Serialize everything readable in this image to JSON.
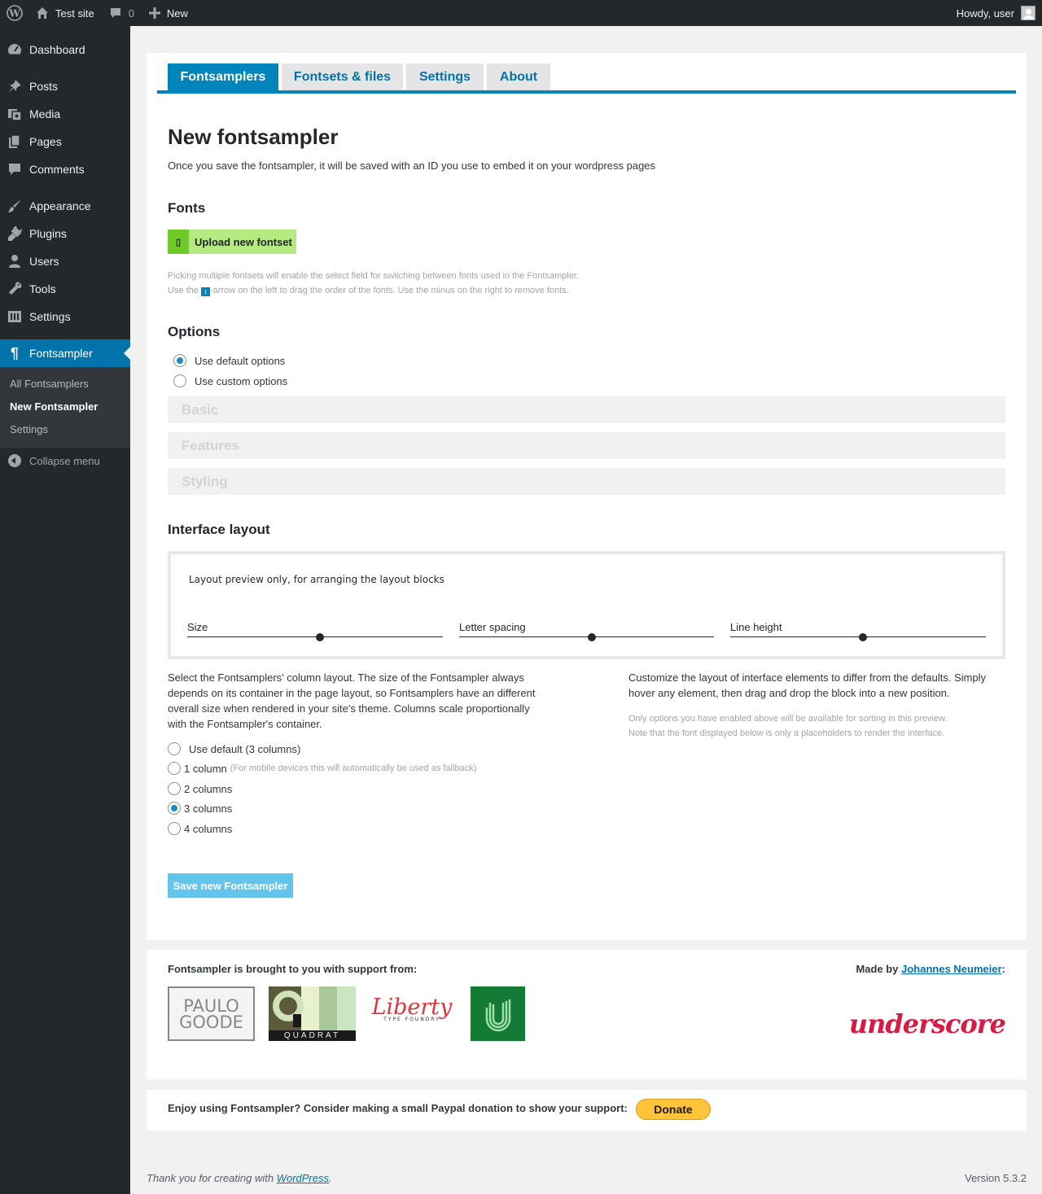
{
  "adminbar": {
    "site_name": "Test site",
    "comments_count": "0",
    "new_label": "New",
    "howdy": "Howdy, user"
  },
  "sidebar": {
    "items": [
      {
        "label": "Dashboard",
        "icon": "dashboard-icon"
      },
      {
        "label": "Posts",
        "icon": "pin-icon"
      },
      {
        "label": "Media",
        "icon": "media-icon"
      },
      {
        "label": "Pages",
        "icon": "pages-icon"
      },
      {
        "label": "Comments",
        "icon": "comment-icon"
      },
      {
        "label": "Appearance",
        "icon": "brush-icon"
      },
      {
        "label": "Plugins",
        "icon": "plug-icon"
      },
      {
        "label": "Users",
        "icon": "user-icon"
      },
      {
        "label": "Tools",
        "icon": "wrench-icon"
      },
      {
        "label": "Settings",
        "icon": "settings-icon"
      },
      {
        "label": "Fontsampler",
        "icon": "pilcrow-icon"
      }
    ],
    "submenu": [
      "All Fontsamplers",
      "New Fontsampler",
      "Settings"
    ],
    "collapse_label": "Collapse menu"
  },
  "tabs": [
    "Fontsamplers",
    "Fontsets & files",
    "Settings",
    "About"
  ],
  "page": {
    "title": "New fontsampler",
    "intro": "Once you save the fontsampler, it will be saved with an ID you use to embed it on your wordpress pages"
  },
  "fonts": {
    "heading": "Fonts",
    "upload_label": "Upload new fontset",
    "note1": "Picking multiple fontsets will enable the select field for switching between fonts used in the Fontsampler.",
    "note2a": "Use the",
    "note2b": "-arrow on the left to drag the order of the fonts. Use the minus on the right to remove fonts."
  },
  "options": {
    "heading": "Options",
    "radio_default": "Use default options",
    "radio_custom": "Use custom options",
    "sections": [
      "Basic",
      "Features",
      "Styling"
    ]
  },
  "interface": {
    "heading": "Interface layout",
    "preview_title": "Layout preview only, for arranging the layout blocks",
    "sliders": [
      {
        "label": "Size",
        "value": 0.52
      },
      {
        "label": "Letter spacing",
        "value": 0.52
      },
      {
        "label": "Line height",
        "value": 0.52
      }
    ],
    "left_desc": "Select the Fontsamplers' column layout. The size of the Fontsampler always depends on its container in the page layout, so Fontsamplers have an different overall size when rendered in your site's theme. Columns scale proportionally with the Fontsampler's container.",
    "right_desc": "Customize the layout of interface elements to differ from the defaults. Simply hover any element, then drag and drop the block into a new position.",
    "right_note1": "Only options you have enabled above will be available for sorting in this preview.",
    "right_note2": "Note that the font displayed below is only a placeholders to render the interface.",
    "columns": [
      {
        "label": "Use default (3 columns)",
        "note": ""
      },
      {
        "label": "1 column",
        "note": "(For mobile devices this will automatically be used as fallback)"
      },
      {
        "label": "2 columns",
        "note": ""
      },
      {
        "label": "3 columns",
        "note": ""
      },
      {
        "label": "4 columns",
        "note": ""
      }
    ],
    "selected_column": "3 columns"
  },
  "save_label": "Save new Fontsampler",
  "support": {
    "title": "Fontsampler is brought to you with support from:",
    "made_by_prefix": "Made by",
    "author": "Johannes Neumeier",
    "made_by_suffix": ":",
    "logos": {
      "paulo_line1": "PAULO",
      "paulo_line2": "GOODE",
      "quadrat": "QUADRAT",
      "liberty": "Liberty",
      "liberty_sub": "TYPE FOUNDRY",
      "underscore": "underscore"
    }
  },
  "donate": {
    "text": "Enjoy using Fontsampler? Consider making a small Paypal donation to show your support:",
    "button": "Donate"
  },
  "footer": {
    "thanks_prefix": "Thank you for creating with",
    "link": "WordPress",
    "thanks_suffix": ".",
    "version": "Version 5.3.2"
  },
  "colors": {
    "accent": "#0085ba",
    "sidebar_bg": "#23282d",
    "upload_green": "#b5ea81",
    "save_blue": "#64c5ec",
    "donate_yellow": "#ffc439"
  }
}
